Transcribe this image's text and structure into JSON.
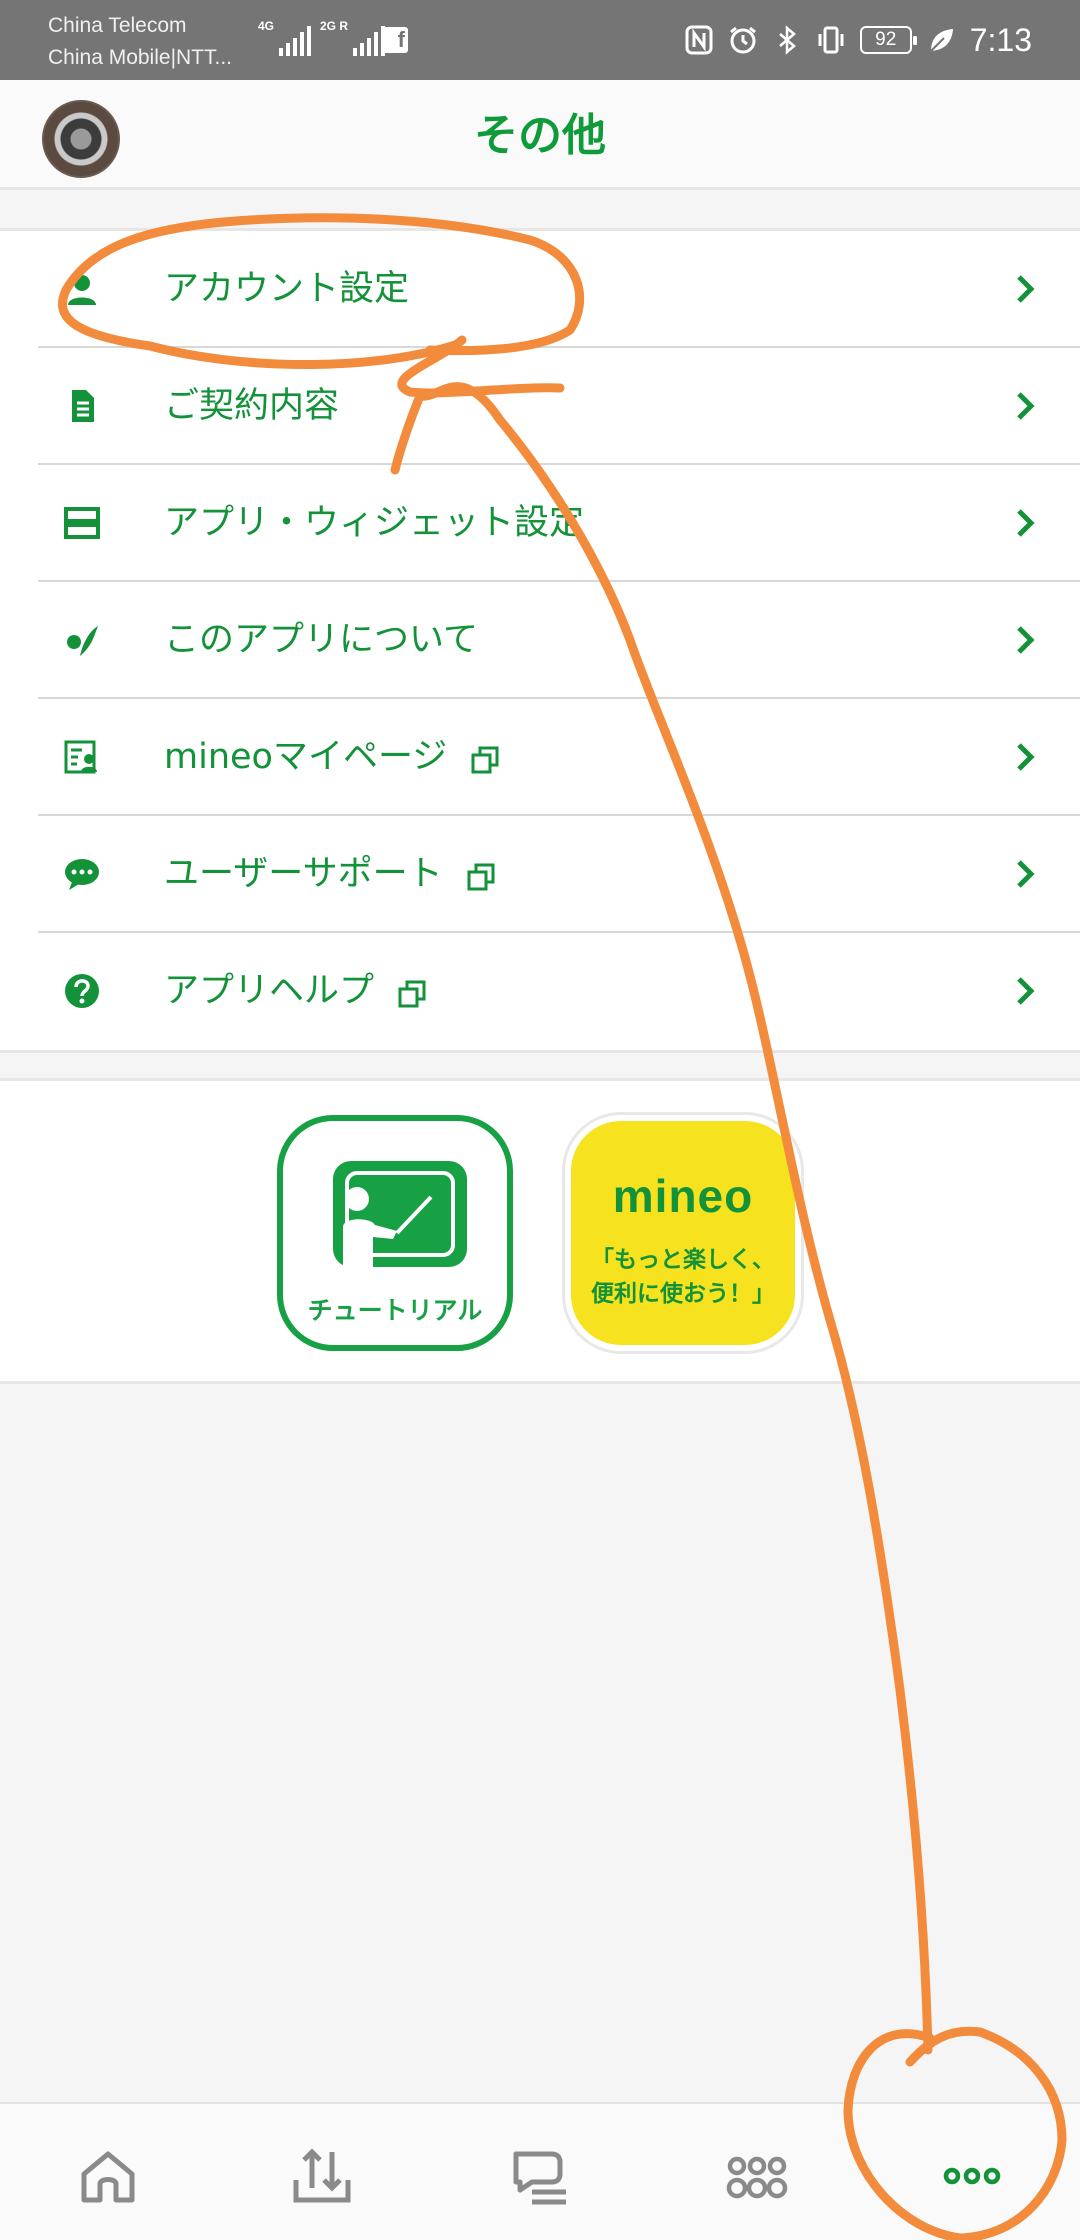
{
  "status_bar": {
    "carrier1": "China Telecom",
    "carrier2": "China Mobile|NTT...",
    "signal1_tag": "4G",
    "signal2_tag": "2G R",
    "battery": "92",
    "time": "7:13"
  },
  "header": {
    "title": "その他"
  },
  "menu": {
    "items": [
      {
        "label": "アカウント設定",
        "icon": "account-icon",
        "external": false
      },
      {
        "label": "ご契約内容",
        "icon": "contract-icon",
        "external": false
      },
      {
        "label": "アプリ・ウィジェット設定",
        "icon": "widget-icon",
        "external": false
      },
      {
        "label": "このアプリについて",
        "icon": "about-icon",
        "external": false
      },
      {
        "label": "mineoマイページ",
        "icon": "mypage-icon",
        "external": true
      },
      {
        "label": "ユーザーサポート",
        "icon": "chat-icon",
        "external": true
      },
      {
        "label": "アプリヘルプ",
        "icon": "help-icon",
        "external": true
      }
    ]
  },
  "banners": {
    "tutorial_label": "チュートリアル",
    "mineo_logo": "mineo",
    "mineo_tagline_1": "「もっと楽しく、",
    "mineo_tagline_2": "便利に使おう！」"
  },
  "bottom_nav": {
    "items": [
      "home-icon",
      "data-transfer-icon",
      "community-icon",
      "services-icon",
      "more-icon"
    ],
    "active": "more-icon"
  },
  "colors": {
    "brand_green": "#139239",
    "status_bar": "#757575",
    "annotation_orange": "#f28c3c",
    "mineo_yellow": "#f6e21e"
  }
}
